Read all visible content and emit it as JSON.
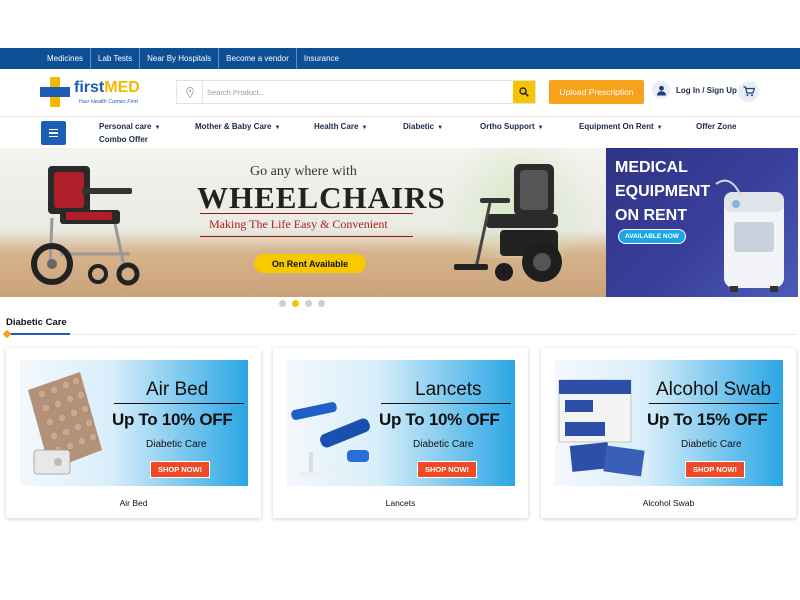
{
  "topnav": [
    "Medicines",
    "Lab Tests",
    "Near By Hospitals",
    "Become a vendor",
    "Insurance"
  ],
  "logo": {
    "first": "first",
    "med": "MED",
    "tagline": "Your Health Comes First"
  },
  "search": {
    "placeholder": "Search Product..."
  },
  "header": {
    "upload_label": "Upload Prescription",
    "login_label": "Log In / Sign Up"
  },
  "categories": [
    {
      "label": "Personal care"
    },
    {
      "label": "Mother & Baby Care"
    },
    {
      "label": "Health Care"
    },
    {
      "label": "Diabetic"
    },
    {
      "label": "Ortho Support"
    },
    {
      "label": "Equipment On Rent"
    },
    {
      "label": "Offer Zone"
    },
    {
      "label": "Combo Offer"
    }
  ],
  "hero": {
    "line1": "Go any where with",
    "line2": "WHEELCHAIRS",
    "line3": "Making The Life Easy & Convenient",
    "cta": "On Rent Available"
  },
  "side_banner": {
    "line1": "MEDICAL",
    "line2": "EQUIPMENT",
    "line3": "ON RENT",
    "pill": "AVAILABLE NOW"
  },
  "section": {
    "title": "Diabetic Care"
  },
  "products": [
    {
      "title": "Air Bed",
      "offer": "Up To 10% OFF",
      "sub": "Diabetic Care",
      "shop": "SHOP NOW!",
      "caption": "Air Bed"
    },
    {
      "title": "Lancets",
      "offer": "Up To 10% OFF",
      "sub": "Diabetic Care",
      "shop": "SHOP NOW!",
      "caption": "Lancets"
    },
    {
      "title": "Alcohol Swab",
      "offer": "Up To 15% OFF",
      "sub": "Diabetic Care",
      "shop": "SHOP NOW!",
      "caption": "Alcohol Swab"
    }
  ],
  "colors": {
    "primary": "#0d4f94",
    "accent": "#f5c400",
    "upload": "#f7a21b",
    "shop": "#ef4a25"
  }
}
